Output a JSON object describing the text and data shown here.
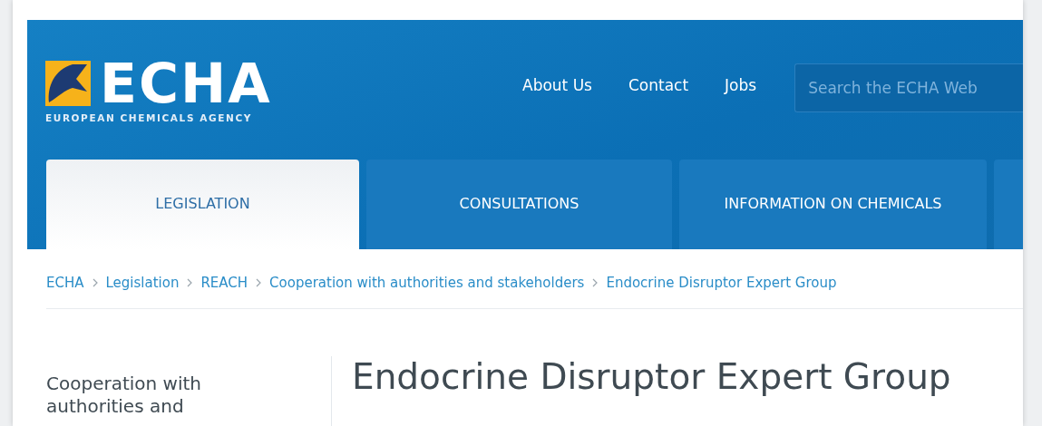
{
  "logo": {
    "name": "ECHA",
    "subtitle": "EUROPEAN CHEMICALS AGENCY"
  },
  "top_links": [
    "About Us",
    "Contact",
    "Jobs"
  ],
  "search": {
    "placeholder": "Search the ECHA Web"
  },
  "tabs": [
    {
      "label": "LEGISLATION",
      "selected": true
    },
    {
      "label": "CONSULTATIONS",
      "selected": false
    },
    {
      "label": "INFORMATION ON CHEMICALS",
      "selected": false
    }
  ],
  "breadcrumb": [
    "ECHA",
    "Legislation",
    "REACH",
    "Cooperation with authorities and stakeholders",
    "Endocrine Disruptor Expert Group"
  ],
  "sidebar": {
    "title": "Cooperation with authorities and"
  },
  "page_title": "Endocrine Disruptor Expert Group"
}
